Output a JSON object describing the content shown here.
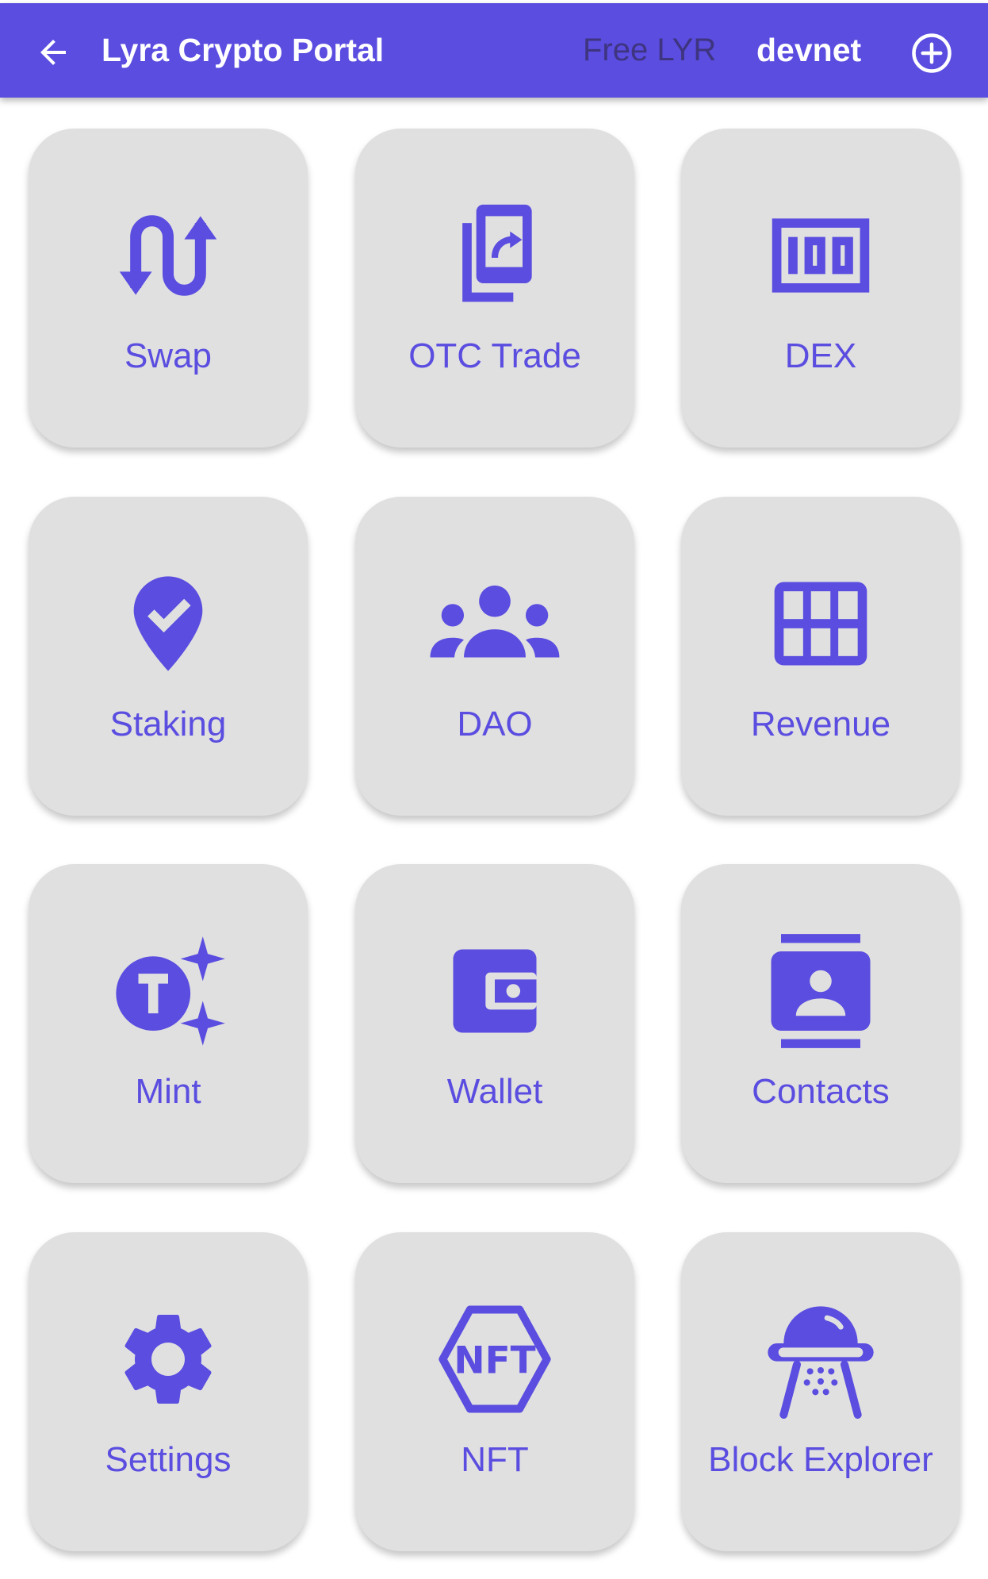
{
  "appbar": {
    "title": "Lyra Crypto Portal",
    "free_lyr": "Free LYR",
    "network": "devnet",
    "back_icon": "arrow-back-icon",
    "add_icon": "add-circle-icon"
  },
  "colors": {
    "primary": "#5a4de0",
    "tile_background": "#e0e0e0",
    "free_lyr_text": "#3e347f"
  },
  "tiles": [
    {
      "label": "Swap",
      "icon": "swap-icon"
    },
    {
      "label": "OTC Trade",
      "icon": "otc-trade-icon"
    },
    {
      "label": "DEX",
      "icon": "dex-icon"
    },
    {
      "label": "Staking",
      "icon": "staking-icon"
    },
    {
      "label": "DAO",
      "icon": "dao-icon"
    },
    {
      "label": "Revenue",
      "icon": "revenue-icon"
    },
    {
      "label": "Mint",
      "icon": "mint-icon"
    },
    {
      "label": "Wallet",
      "icon": "wallet-icon"
    },
    {
      "label": "Contacts",
      "icon": "contacts-icon"
    },
    {
      "label": "Settings",
      "icon": "settings-icon"
    },
    {
      "label": "NFT",
      "icon": "nft-icon"
    },
    {
      "label": "Block Explorer",
      "icon": "block-explorer-icon"
    }
  ]
}
